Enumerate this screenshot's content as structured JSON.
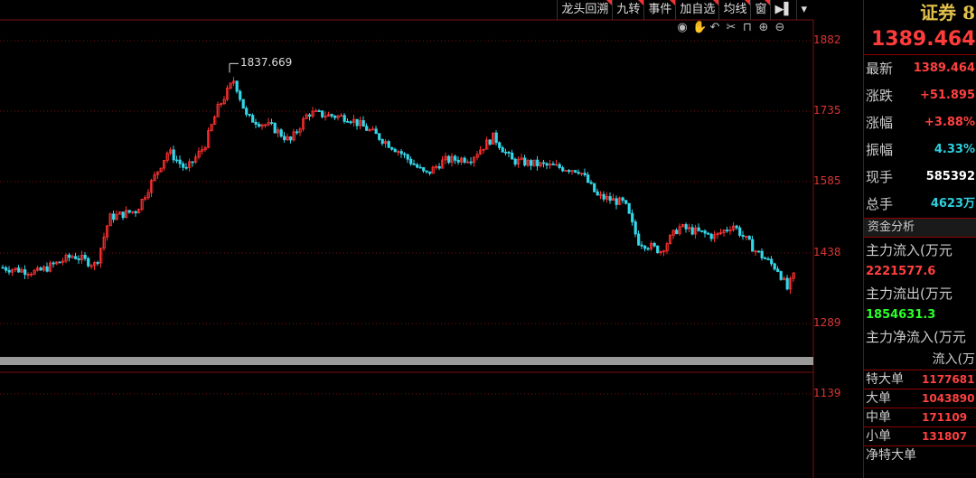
{
  "toolbar": {
    "buttons": [
      "龙头回溯",
      "九转",
      "事件",
      "加自选",
      "均线",
      "窗"
    ],
    "play_icon": "play-icon",
    "dropdown_icon": "dropdown-icon"
  },
  "tools": [
    "eye-icon",
    "hand-icon",
    "undo-icon",
    "scissors-icon",
    "lock-icon",
    "zoom-in-icon",
    "zoom-out-icon"
  ],
  "chart_data": {
    "type": "candlestick",
    "y_ticks": [
      1882,
      1735,
      1585,
      1438,
      1289,
      1139
    ],
    "high_label": "1837.669",
    "ylim": [
      1060,
      1920
    ],
    "colors": {
      "up": "#ff3030",
      "down": "#35d6e8",
      "grid": "#7a1010",
      "volume_bar": "#9a9a9a"
    }
  },
  "panel": {
    "title": "证券 8",
    "price": "1389.464",
    "quotes": [
      {
        "label": "最新",
        "value": "1389.464",
        "color": "red"
      },
      {
        "label": "涨跌",
        "value": "+51.895",
        "color": "red"
      },
      {
        "label": "涨幅",
        "value": "+3.88%",
        "color": "red"
      },
      {
        "label": "振幅",
        "value": "4.33%",
        "color": "cyan"
      },
      {
        "label": "现手",
        "value": "585392",
        "color": "white"
      },
      {
        "label": "总手",
        "value": "4623万",
        "color": "cyan"
      }
    ],
    "fund_section": "资金分析",
    "inflow_label": "主力流入(万元",
    "inflow_value": "2221577.6",
    "outflow_label": "主力流出(万元",
    "outflow_value": "1854631.3",
    "net_label": "主力净流入(万元",
    "table_header": "流入(万",
    "table": [
      {
        "label": "特大单",
        "value": "1177681"
      },
      {
        "label": "大单",
        "value": "1043890"
      },
      {
        "label": "中单",
        "value": "171109"
      },
      {
        "label": "小单",
        "value": "131807"
      }
    ],
    "footer": "净特大单"
  }
}
